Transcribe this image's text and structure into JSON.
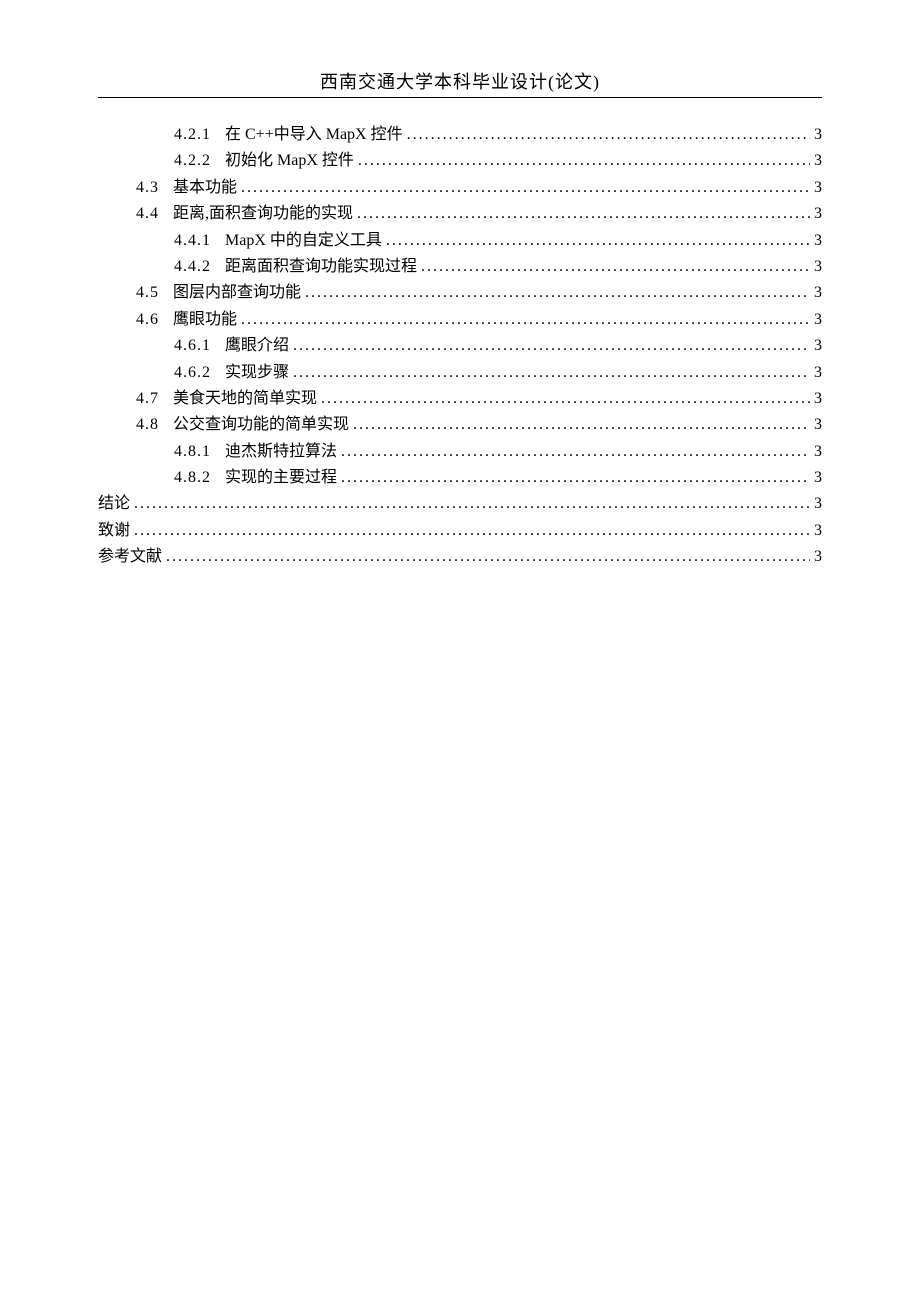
{
  "header": {
    "title": "西南交通大学本科毕业设计(论文)"
  },
  "toc": {
    "entries": [
      {
        "indent": 2,
        "num": "4.2.1",
        "text": "在 C++中导入 MapX 控件",
        "page": "3"
      },
      {
        "indent": 2,
        "num": "4.2.2",
        "text": "初始化 MapX 控件",
        "page": "3"
      },
      {
        "indent": 1,
        "num": "4.3",
        "text": "基本功能",
        "page": "3"
      },
      {
        "indent": 1,
        "num": "4.4",
        "text": "距离,面积查询功能的实现",
        "page": "3"
      },
      {
        "indent": 2,
        "num": "4.4.1",
        "text": "MapX 中的自定义工具",
        "page": "3"
      },
      {
        "indent": 2,
        "num": "4.4.2",
        "text": "距离面积查询功能实现过程",
        "page": "3"
      },
      {
        "indent": 1,
        "num": "4.5",
        "text": "图层内部查询功能",
        "page": "3"
      },
      {
        "indent": 1,
        "num": "4.6",
        "text": "鹰眼功能",
        "page": "3"
      },
      {
        "indent": 2,
        "num": "4.6.1",
        "text": "鹰眼介绍",
        "page": "3"
      },
      {
        "indent": 2,
        "num": "4.6.2",
        "text": "实现步骤",
        "page": "3"
      },
      {
        "indent": 1,
        "num": "4.7",
        "text": "美食天地的简单实现",
        "page": "3"
      },
      {
        "indent": 1,
        "num": "4.8",
        "text": "公交查询功能的简单实现",
        "page": "3"
      },
      {
        "indent": 2,
        "num": "4.8.1",
        "text": "迪杰斯特拉算法",
        "page": "3"
      },
      {
        "indent": 2,
        "num": "4.8.2",
        "text": "实现的主要过程",
        "page": "3"
      },
      {
        "indent": 0,
        "num": "",
        "text": "结论",
        "page": "3"
      },
      {
        "indent": 0,
        "num": "",
        "text": "致谢",
        "page": "3"
      },
      {
        "indent": 0,
        "num": "",
        "text": "参考文献",
        "page": "3"
      }
    ]
  }
}
